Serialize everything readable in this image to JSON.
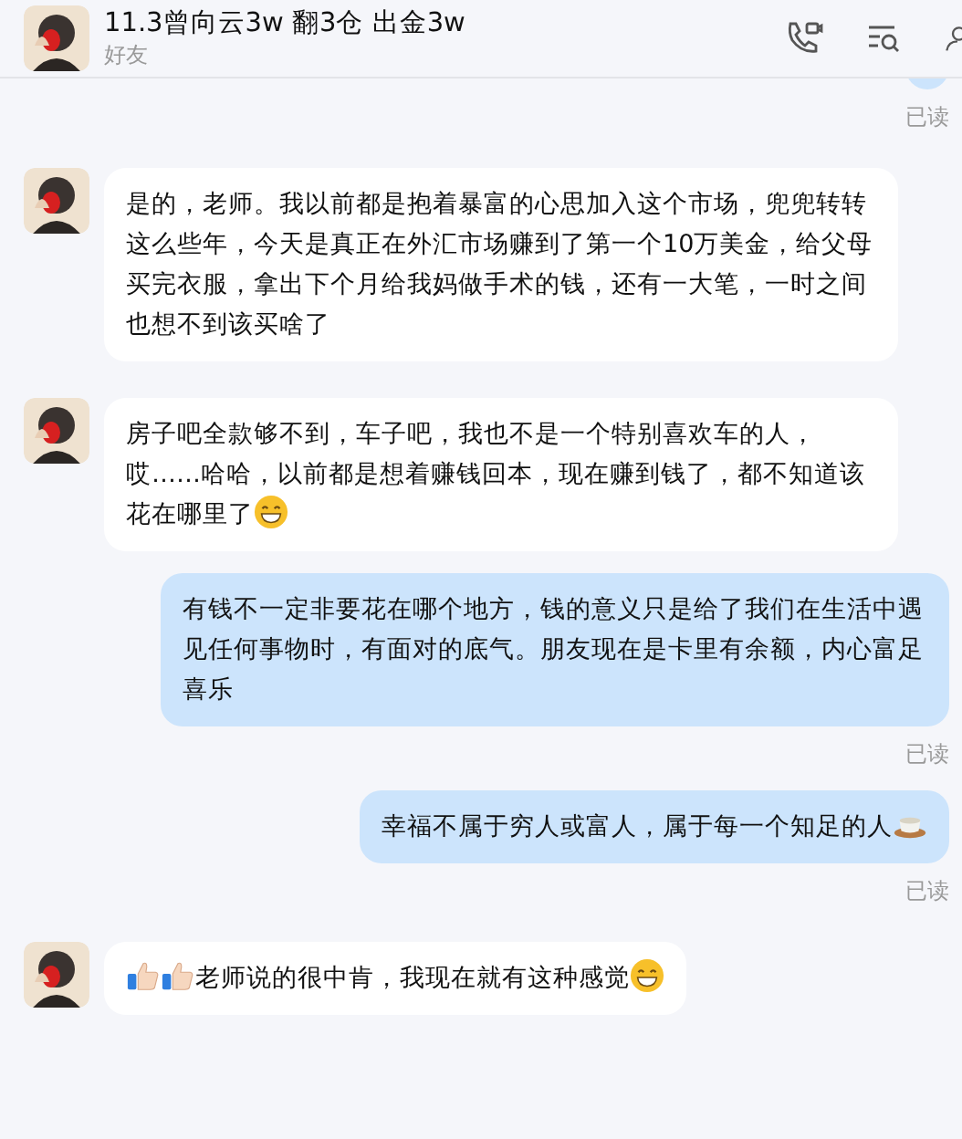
{
  "header": {
    "title": "11.3曾向云3w 翻3仓 出金3w",
    "subtitle": "好友"
  },
  "messages": [
    {
      "kind": "sent-cut",
      "receipt": "已读"
    },
    {
      "kind": "received",
      "parts": [
        {
          "kind": "text",
          "text": "是的，老师。我以前都是抱着暴富的心思加入这个市场，兜兜转转这么些年，今天是真正在外汇市场赚到了第一个10万美金，给父母买完衣服，拿出下个月给我妈做手术的钱，还有一大笔，一时之间也想不到该买啥了"
        }
      ]
    },
    {
      "kind": "received",
      "parts": [
        {
          "kind": "text",
          "text": "房子吧全款够不到，车子吧，我也不是一个特别喜欢车的人，哎……哈哈，以前都是想着赚钱回本，现在赚到钱了，都不知道该花在哪里了"
        },
        {
          "kind": "grin"
        }
      ]
    },
    {
      "kind": "sent",
      "parts": [
        {
          "kind": "text",
          "text": "有钱不一定非要花在哪个地方，钱的意义只是给了我们在生活中遇见任何事物时，有面对的底气。朋友现在是卡里有余额，内心富足喜乐"
        }
      ],
      "receipt": "已读"
    },
    {
      "kind": "sent",
      "parts": [
        {
          "kind": "text",
          "text": "幸福不属于穷人或富人，属于每一个知足的人"
        },
        {
          "kind": "tea"
        }
      ],
      "receipt": "已读"
    },
    {
      "kind": "received",
      "parts": [
        {
          "kind": "thumb"
        },
        {
          "kind": "thumb"
        },
        {
          "kind": "text",
          "text": "老师说的很中肯，我现在就有这种感觉"
        },
        {
          "kind": "grin"
        }
      ]
    }
  ]
}
